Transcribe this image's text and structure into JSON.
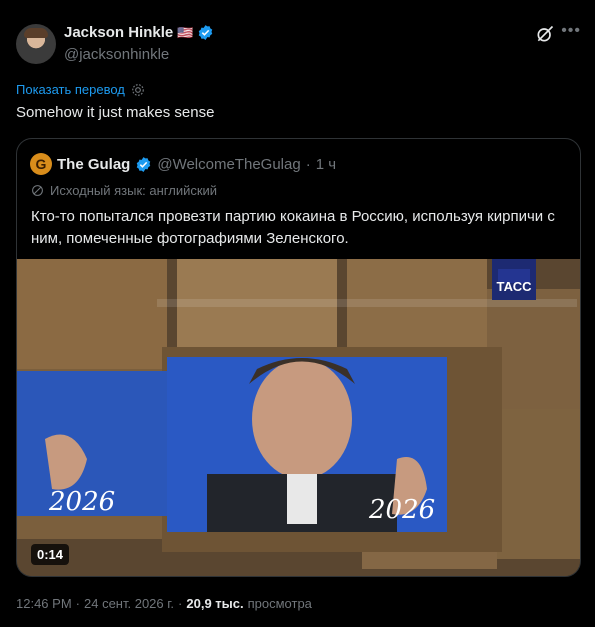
{
  "author": {
    "display_name": "Jackson Hinkle",
    "flag": "🇺🇸",
    "handle": "@jacksonhinkle"
  },
  "translate_link": "Показать перевод",
  "tweet_text": "Somehow it just makes sense",
  "quote": {
    "avatar_letter": "G",
    "display_name": "The Gulag",
    "handle": "@WelcomeTheGulag",
    "separator": "·",
    "time": "1 ч",
    "source_language": "Исходный язык: английский",
    "text": "Кто-то попытался провезти партию кокаина в Россию, используя кирпичи с ним, помеченные фотографиями Зеленского.",
    "media": {
      "watermark": "ТАСС",
      "duration": "0:14",
      "poster_text_left": "2026",
      "poster_text_right": "2026"
    }
  },
  "footer": {
    "time": "12:46 PM",
    "separator": "·",
    "date": "24 сент. 2026 г.",
    "separator2": "·",
    "views": "20,9 тыс.",
    "views_label": "просмотра"
  },
  "colors": {
    "accent": "#1d9bf0",
    "muted": "#71767b",
    "text": "#e7e9ea",
    "border": "#2f3336"
  },
  "icons": [
    "verified-badge-icon",
    "grok-icon",
    "more-icon",
    "gear-icon",
    "globe-icon"
  ]
}
